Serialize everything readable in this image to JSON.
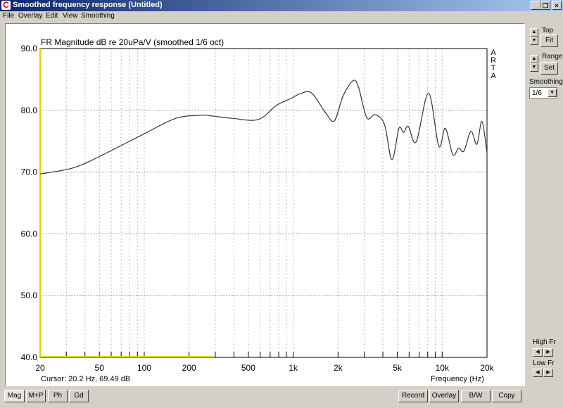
{
  "window": {
    "title": "Smoothed frequency response (Untitled)",
    "minimize": "_",
    "restore": "❐",
    "close": "×"
  },
  "menu": [
    "File",
    "Overlay",
    "Edit",
    "View",
    "Smoothing"
  ],
  "side": {
    "top_label": "Top",
    "fit": "Fit",
    "range_label": "Range",
    "set": "Set",
    "smoothing_label": "Smoothing",
    "smoothing_value": "1/6",
    "high_fr": "High Fr",
    "low_fr": "Low Fr"
  },
  "bottom_left": [
    "Mag",
    "M+P",
    "Ph",
    "Gd"
  ],
  "bottom_right": [
    "Record",
    "Overlay",
    "B/W",
    "Copy"
  ],
  "cursor": "Cursor: 20.2 Hz, 69.49 dB",
  "brand": [
    "A",
    "R",
    "T",
    "A"
  ],
  "chart_data": {
    "type": "line",
    "title": "FR Magnitude dB re 20uPa/V (smoothed 1/6 oct)",
    "xlabel": "Frequency (Hz)",
    "ylabel": "",
    "xscale": "log",
    "xlim": [
      20,
      20000
    ],
    "ylim": [
      40,
      90
    ],
    "xticks": [
      {
        "v": 20,
        "l": "20"
      },
      {
        "v": 50,
        "l": "50"
      },
      {
        "v": 100,
        "l": "100"
      },
      {
        "v": 200,
        "l": "200"
      },
      {
        "v": 500,
        "l": "500"
      },
      {
        "v": 1000,
        "l": "1k"
      },
      {
        "v": 2000,
        "l": "2k"
      },
      {
        "v": 5000,
        "l": "5k"
      },
      {
        "v": 10000,
        "l": "10k"
      },
      {
        "v": 20000,
        "l": "20k"
      }
    ],
    "yticks": [
      {
        "v": 40,
        "l": "40.0"
      },
      {
        "v": 50,
        "l": "50.0"
      },
      {
        "v": 60,
        "l": "60.0"
      },
      {
        "v": 70,
        "l": "70.0"
      },
      {
        "v": 80,
        "l": "80.0"
      },
      {
        "v": 90,
        "l": "90.0"
      }
    ],
    "grid": true,
    "marked_range_hz": [
      20,
      290
    ],
    "series": [
      {
        "name": "Magnitude",
        "x": [
          20,
          30,
          40,
          65,
          100,
          163,
          240,
          282,
          390,
          581,
          773,
          962,
          1120,
          1330,
          1650,
          1890,
          2160,
          2520,
          2740,
          3120,
          3550,
          4100,
          4600,
          5130,
          5500,
          5930,
          6700,
          8100,
          9490,
          10500,
          11800,
          12900,
          14000,
          15600,
          17100,
          18500,
          20000
        ],
        "y": [
          69.7,
          70.4,
          71.4,
          73.9,
          76.2,
          78.7,
          79.2,
          79.1,
          78.7,
          78.5,
          80.8,
          81.9,
          82.7,
          82.8,
          79.6,
          78.3,
          82.3,
          84.8,
          83.8,
          78.8,
          79.3,
          77.7,
          72.0,
          77.1,
          76.4,
          77.4,
          74.9,
          82.8,
          74.2,
          77.1,
          72.8,
          73.9,
          73.4,
          76.6,
          74.5,
          78.2,
          73.1
        ]
      }
    ]
  }
}
